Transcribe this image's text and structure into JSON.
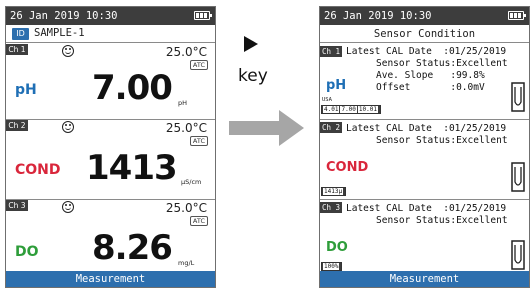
{
  "left": {
    "datetime": "26 Jan 2019 10:30",
    "sample_tag": "ID",
    "sample_name": "SAMPLE-1",
    "channels": [
      {
        "badge": "Ch 1",
        "label": "pH",
        "color": "#1f6fb5",
        "temp": "25.0°C",
        "atc": "ATC",
        "value": "7.00",
        "unit": "pH"
      },
      {
        "badge": "Ch 2",
        "label": "COND",
        "color": "#d9263b",
        "temp": "25.0°C",
        "atc": "ATC",
        "value": "1413",
        "unit": "µS/cm"
      },
      {
        "badge": "Ch 3",
        "label": "DO",
        "color": "#2e9d3a",
        "temp": "25.0°C",
        "atc": "ATC",
        "value": "8.26",
        "unit": "mg/L"
      }
    ],
    "footer": "Measurement"
  },
  "middle": {
    "key_label": "key"
  },
  "right": {
    "datetime": "26 Jan 2019 10:30",
    "title": "Sensor Condition",
    "channels": [
      {
        "badge": "Ch 1",
        "label": "pH",
        "color": "#1f6fb5",
        "line1": "Latest CAL Date  :01/25/2019",
        "line2": "Sensor Status:Excellent",
        "line3": "Ave. Slope   :99.8%",
        "line4": "Offset       :0.0mV",
        "small": "USA",
        "buffers": [
          "4.01",
          "7.00",
          "10.01"
        ]
      },
      {
        "badge": "Ch 2",
        "label": "COND",
        "color": "#d9263b",
        "line1": "Latest CAL Date  :01/25/2019",
        "line2": "Sensor Status:Excellent",
        "buffer": "1413µ"
      },
      {
        "badge": "Ch 3",
        "label": "DO",
        "color": "#2e9d3a",
        "line1": "Latest CAL Date  :01/25/2019",
        "line2": "Sensor Status:Excellent",
        "buffer": "100%"
      }
    ],
    "footer": "Measurement"
  }
}
